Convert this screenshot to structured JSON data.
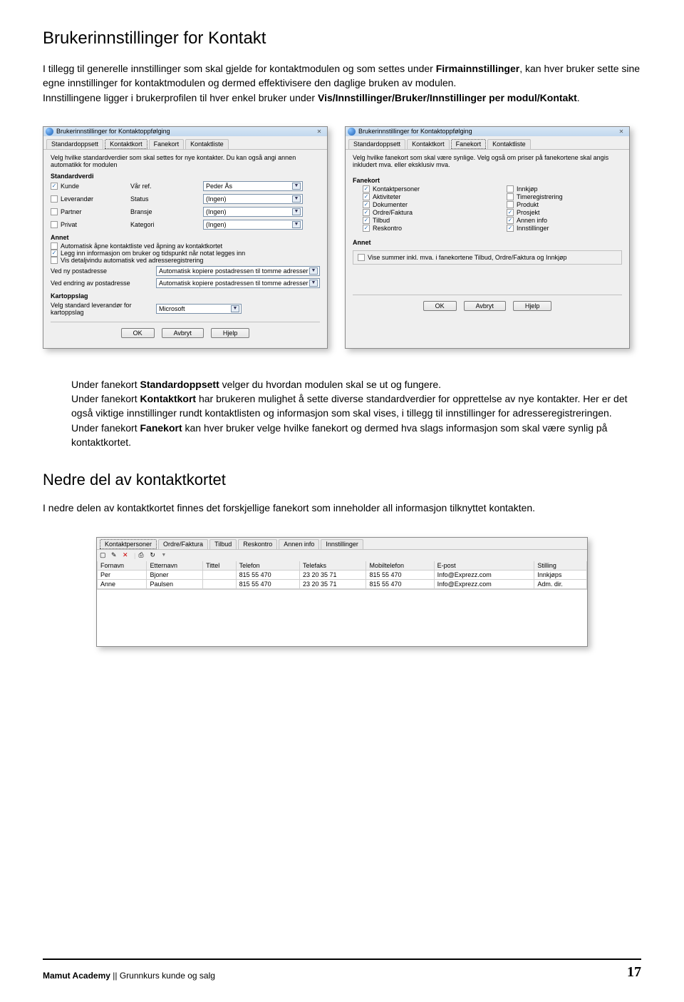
{
  "title": "Brukerinnstillinger for Kontakt",
  "p1": {
    "a": "I tillegg til generelle innstillinger som skal gjelde for kontaktmodulen og som settes under ",
    "b": "Firmainnstillinger",
    "c": ", kan hver bruker sette sine egne innstillinger for kontaktmodulen og dermed effektivisere den daglige bruken av modulen.",
    "d": "Innstillingene ligger i brukerprofilen til hver enkel bruker under ",
    "e": "Vis/Innstillinger/Bruker/Innstillinger per modul/Kontakt",
    "f": "."
  },
  "win_title": "Brukerinnstillinger for Kontaktoppfølging",
  "close_glyph": "✕",
  "tabs": {
    "a": "Standardoppsett",
    "b": "Kontaktkort",
    "c": "Fanekort",
    "d": "Kontaktliste"
  },
  "winA": {
    "desc": "Velg hvilke standardverdier som skal settes for nye kontakter. Du kan også angi annen automatikk for modulen",
    "std_hdr": "Standardverdi",
    "std": {
      "r1": {
        "chk": "Kunde",
        "lbl": "Vår ref.",
        "dd": "Peder Ås"
      },
      "r2": {
        "chk": "Leverandør",
        "lbl": "Status",
        "dd": "(Ingen)"
      },
      "r3": {
        "chk": "Partner",
        "lbl": "Bransje",
        "dd": "(Ingen)"
      },
      "r4": {
        "chk": "Privat",
        "lbl": "Kategori",
        "dd": "(Ingen)"
      }
    },
    "annet_hdr": "Annet",
    "annet_chk": [
      "Automatisk åpne kontaktliste ved åpning av kontaktkortet",
      "Legg inn informasjon om bruker og tidspunkt når notat legges inn",
      "Vis detaljvindu automatisk ved adresseregistrering"
    ],
    "kv": [
      {
        "label": "Ved ny postadresse",
        "dd": "Automatisk kopiere postadressen til tomme adresser"
      },
      {
        "label": "Ved endring av postadresse",
        "dd": "Automatisk kopiere postadressen til tomme adresser"
      }
    ],
    "kart_hdr": "Kartoppslag",
    "kart_label": "Velg standard leverandør for kartoppslag",
    "kart_dd": "Microsoft"
  },
  "winB": {
    "desc": "Velg hvilke fanekort som skal være synlige. Velg også om priser på fanekortene skal angis inkludert mva. eller eksklusiv mva.",
    "hdr": "Fanekort",
    "left": [
      {
        "c": true,
        "t": "Kontaktpersoner"
      },
      {
        "c": true,
        "t": "Aktiviteter"
      },
      {
        "c": true,
        "t": "Dokumenter"
      },
      {
        "c": true,
        "t": "Ordre/Faktura"
      },
      {
        "c": true,
        "t": "Tilbud"
      },
      {
        "c": true,
        "t": "Reskontro"
      }
    ],
    "right": [
      {
        "c": false,
        "t": "Innkjøp"
      },
      {
        "c": false,
        "t": "Timeregistrering"
      },
      {
        "c": false,
        "t": "Produkt"
      },
      {
        "c": true,
        "t": "Prosjekt"
      },
      {
        "c": true,
        "t": "Annen info"
      },
      {
        "c": true,
        "t": "Innstillinger"
      }
    ],
    "annet_hdr": "Annet",
    "annet_chk": "Vise summer inkl. mva. i fanekortene Tilbud, Ordre/Faktura og Innkjøp"
  },
  "buttons": {
    "ok": "OK",
    "cancel": "Avbryt",
    "help": "Hjelp"
  },
  "p2": {
    "a": "Under fanekort ",
    "b": "Standardoppsett",
    "c": " velger du hvordan modulen skal se ut og fungere.",
    "d": "Under fanekort ",
    "e": "Kontaktkort",
    "f": " har brukeren mulighet å sette diverse standardverdier for opprettelse av nye kontakter. Her er det også viktige innstillinger rundt kontaktlisten og informasjon som skal vises, i tillegg til innstillinger for adresseregistreringen.",
    "g": "Under fanekort ",
    "h": "Fanekort",
    "i": " kan hver bruker velge hvilke fanekort og dermed hva slags informasjon som skal være synlig på kontaktkortet."
  },
  "h2": "Nedre del av kontaktkortet",
  "p3": "I nedre delen av kontaktkortet finnes det forskjellige fanekort som inneholder all informasjon tilknyttet kontakten.",
  "grid": {
    "tabs": [
      "Kontaktpersoner",
      "Ordre/Faktura",
      "Tilbud",
      "Reskontro",
      "Annen info",
      "Innstillinger"
    ],
    "tb_glyphs": {
      "new": "▢",
      "edit": "✎",
      "del": "✕",
      "print": "⎙",
      "ref": "↻"
    },
    "cols": [
      "Fornavn",
      "Etternavn",
      "Tittel",
      "Telefon",
      "Telefaks",
      "Mobiltelefon",
      "E-post",
      "Stilling"
    ],
    "rows": [
      [
        "Per",
        "Bjoner",
        "",
        "815 55 470",
        "23 20 35 71",
        "815 55 470",
        "Info@Exprezz.com",
        "Innkjøps"
      ],
      [
        "Anne",
        "Paulsen",
        "",
        "815 55 470",
        "23 20 35 71",
        "815 55 470",
        "Info@Exprezz.com",
        "Adm. dir."
      ]
    ]
  },
  "footer": {
    "left_a": "Mamut Academy",
    "left_b": " || Grunnkurs kunde og salg",
    "page": "17"
  },
  "check_glyph": "✓",
  "dd_glyph": "▼"
}
